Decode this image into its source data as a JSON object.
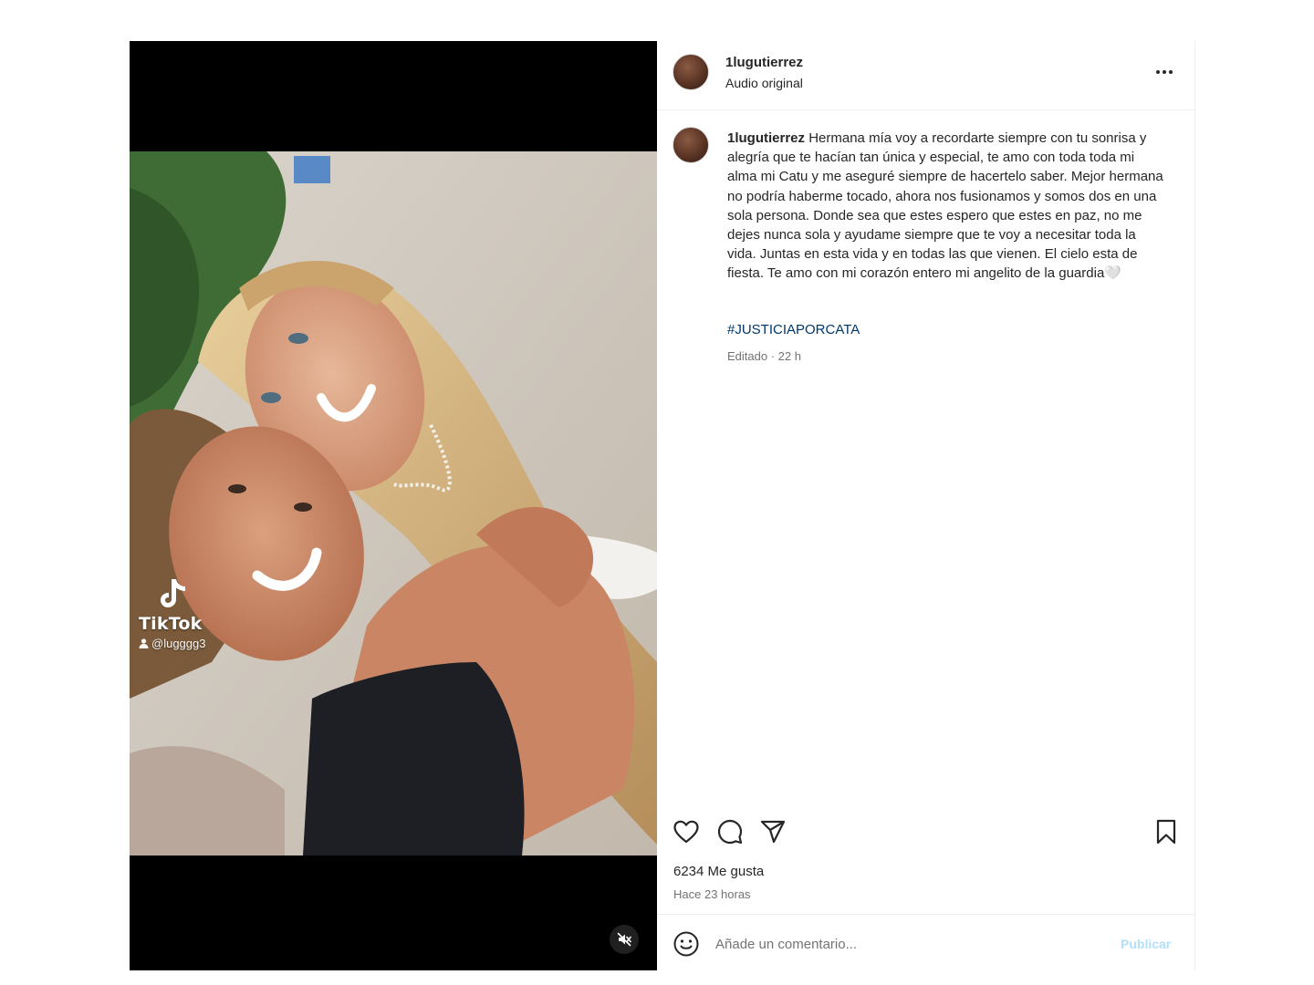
{
  "post": {
    "username": "1lugutierrez",
    "audio_label": "Audio original",
    "caption_user": "1lugutierrez",
    "caption_text": "Hermana mía voy a recordarte siempre con tu sonrisa y alegría que te hacían tan única y especial, te amo con toda toda mi alma mi Catu y me aseguré siempre de hacertelo saber. Mejor hermana no podría haberme tocado, ahora nos fusionamos y somos dos en una sola persona. Donde sea que estes espero que estes en paz, no me dejes nunca sola y ayudame siempre que te voy a necesitar toda la vida. Juntas en esta vida y en todas las que vienen. El cielo esta de fiesta. Te amo con mi corazón entero mi angelito de la guardia🤍",
    "hashtag": "#JUSTICIAPORCATA",
    "edited_label": "Editado · 22 h",
    "likes_label": "6234 Me gusta",
    "time_ago": "Hace 23 horas"
  },
  "media": {
    "watermark_brand": "TikTok",
    "watermark_handle": "@lugggg3"
  },
  "comment_bar": {
    "placeholder": "Añade un comentario...",
    "publish_label": "Publicar"
  },
  "icons": {
    "like": "heart-icon",
    "comment": "comment-icon",
    "share": "send-icon",
    "save": "bookmark-icon",
    "more": "more-icon",
    "emoji": "emoji-icon",
    "mute": "muted-speaker-icon"
  },
  "colors": {
    "hashtag": "#00376b",
    "publish_disabled": "#b2dffc",
    "secondary_text": "#737373"
  }
}
